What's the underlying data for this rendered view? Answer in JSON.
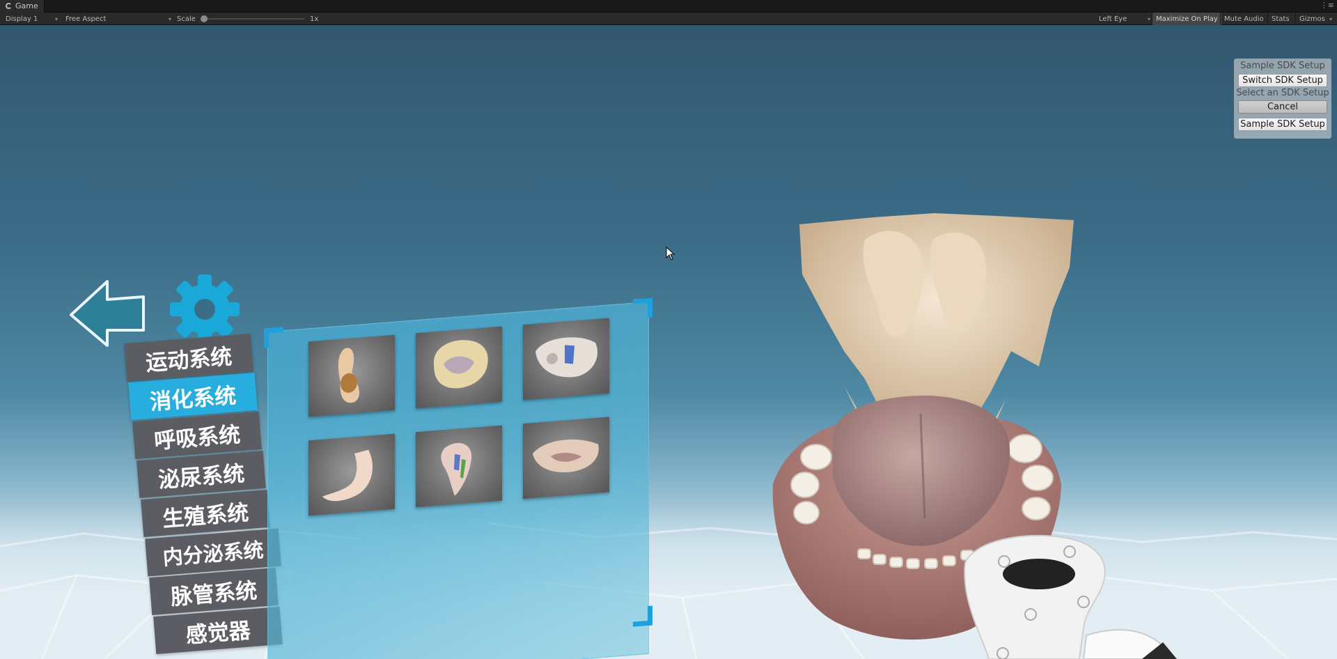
{
  "window": {
    "tab_title": "Game",
    "tab_menu": "⋮≡"
  },
  "toolbar": {
    "display": "Display 1",
    "aspect": "Free Aspect",
    "scale_label": "Scale",
    "scale_value": "1x",
    "eye": "Left Eye",
    "maximize": "Maximize On Play",
    "mute": "Mute Audio",
    "stats": "Stats",
    "gizmos": "Gizmos"
  },
  "sdk_panel": {
    "title": "Sample SDK Setup",
    "switch_button": "Switch SDK Setup",
    "select_label": "Select an SDK Setup",
    "cancel_button": "Cancel",
    "option_button": "Sample SDK Setup"
  },
  "menu": {
    "categories": [
      {
        "label": "运动系统",
        "active": false
      },
      {
        "label": "消化系统",
        "active": true
      },
      {
        "label": "呼吸系统",
        "active": false
      },
      {
        "label": "泌尿系统",
        "active": false
      },
      {
        "label": "生殖系统",
        "active": false
      },
      {
        "label": "内分泌系统",
        "active": false
      },
      {
        "label": "脉管系统",
        "active": false
      },
      {
        "label": "感觉器",
        "active": false
      }
    ]
  },
  "colors": {
    "accent": "#27aede",
    "category_bg": "#5b5d62",
    "panel": "#48a8cd"
  },
  "icons": [
    "back-arrow-icon",
    "gear-icon",
    "mouse-cursor-icon"
  ]
}
